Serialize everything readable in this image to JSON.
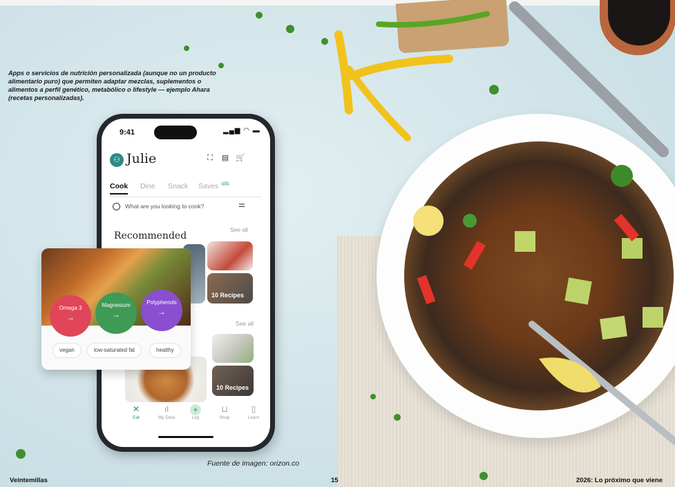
{
  "page": {
    "caption": "Apps o servicios de nutrición personalizada (aunque no un producto alimentario puro) que permiten adaptar mezclas, suplementos o alimentos a perfil genético, metabólico o lifestyle — ejemplo Ahara (recetas personalizadas).",
    "source": "Fuente de imagen: orizon.co",
    "footer_left": "Veintemillas",
    "page_number": "15",
    "footer_right": "2026: Lo próximo que viene"
  },
  "phone": {
    "status_time": "9:41",
    "user_name": "Julie",
    "tabs": [
      {
        "label": "Cook",
        "active": true
      },
      {
        "label": "Dine",
        "active": false
      },
      {
        "label": "Snack",
        "active": false
      },
      {
        "label": "Saves",
        "badge": "101",
        "active": false
      }
    ],
    "search_placeholder": "What are you looking to cook?",
    "recommended_title": "Recommended",
    "see_all_1": "See all",
    "see_all_2": "See all",
    "thumb_label_1": "10 Recipes",
    "thumb_label_2": "10 Recipes",
    "nav": [
      {
        "label": "Eat",
        "icon": "fork-knife-icon",
        "active": true
      },
      {
        "label": "My Data",
        "icon": "bar-chart-icon",
        "active": false
      },
      {
        "label": "Log",
        "icon": "plus-icon",
        "active": false
      },
      {
        "label": "Shop",
        "icon": "cart-icon",
        "active": false
      },
      {
        "label": "Learn",
        "icon": "book-icon",
        "active": false
      }
    ]
  },
  "card": {
    "nutrients": [
      {
        "label": "Omega 3",
        "color": "#e0455a"
      },
      {
        "label": "Magnesium",
        "color": "#3f9a55"
      },
      {
        "label": "Polyphenols",
        "color": "#8a4fd0"
      }
    ],
    "tags": [
      "vegan",
      "low-saturated fat",
      "healthy"
    ]
  },
  "colors": {
    "brand_teal": "#2d8a86"
  }
}
